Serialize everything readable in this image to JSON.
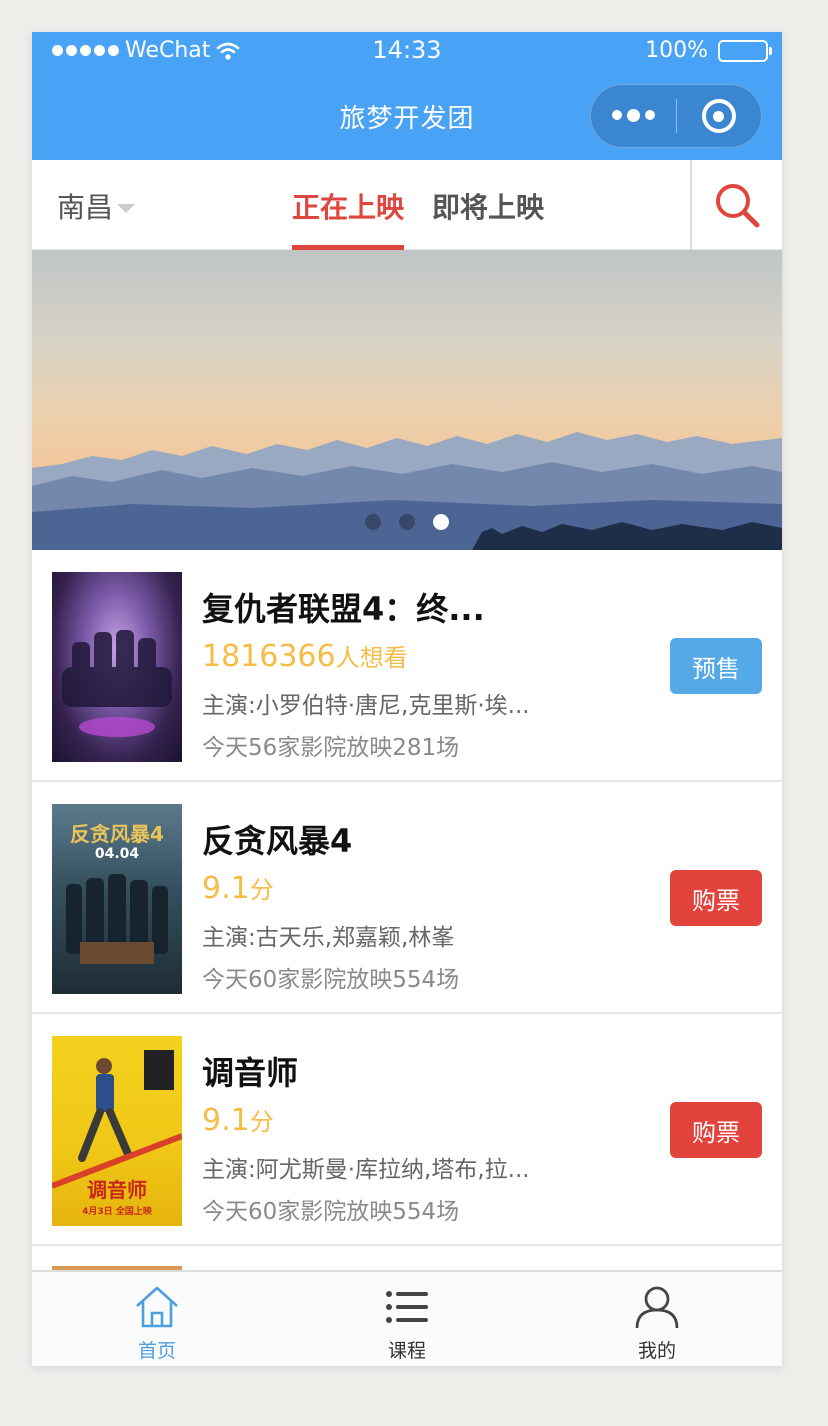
{
  "status_bar": {
    "carrier": "WeChat",
    "time": "14:33",
    "battery": "100%"
  },
  "nav": {
    "title": "旅梦开发团"
  },
  "toolbar": {
    "city": "南昌",
    "tabs": [
      "正在上映",
      "即将上映"
    ],
    "active_tab": "正在上映"
  },
  "banner": {
    "slide_count": 3,
    "active_slide": 3
  },
  "colors": {
    "nav_blue": "#48a2f6",
    "accent_red": "#e0463e",
    "highlight_yellow": "#f6bc46",
    "presale_blue": "#55a9e7",
    "buy_red": "#e2433b"
  },
  "movies": [
    {
      "title": "复仇者联盟4：终...",
      "stat_value": "1816366",
      "stat_unit": "人想看",
      "cast": "主演:小罗伯特·唐尼,克里斯·埃...",
      "showing": "今天56家影院放映281场",
      "button": "预售"
    },
    {
      "title": "反贪风暴4",
      "stat_value": "9.1",
      "stat_unit": "分",
      "cast": "主演:古天乐,郑嘉颖,林峯",
      "showing": "今天60家影院放映554场",
      "button": "购票"
    },
    {
      "title": "调音师",
      "stat_value": "9.1",
      "stat_unit": "分",
      "cast": "主演:阿尤斯曼·库拉纳,塔布,拉...",
      "showing": "今天60家影院放映554场",
      "button": "购票"
    }
  ],
  "posters": {
    "p2_title": "反贪风暴4",
    "p2_date": "04.04",
    "p3_title": "调音师",
    "p3_date": "4月3日 全国上映"
  },
  "bottom_nav": [
    {
      "label": "首页",
      "icon": "home-icon",
      "active": true
    },
    {
      "label": "课程",
      "icon": "list-icon",
      "active": false
    },
    {
      "label": "我的",
      "icon": "user-icon",
      "active": false
    }
  ]
}
